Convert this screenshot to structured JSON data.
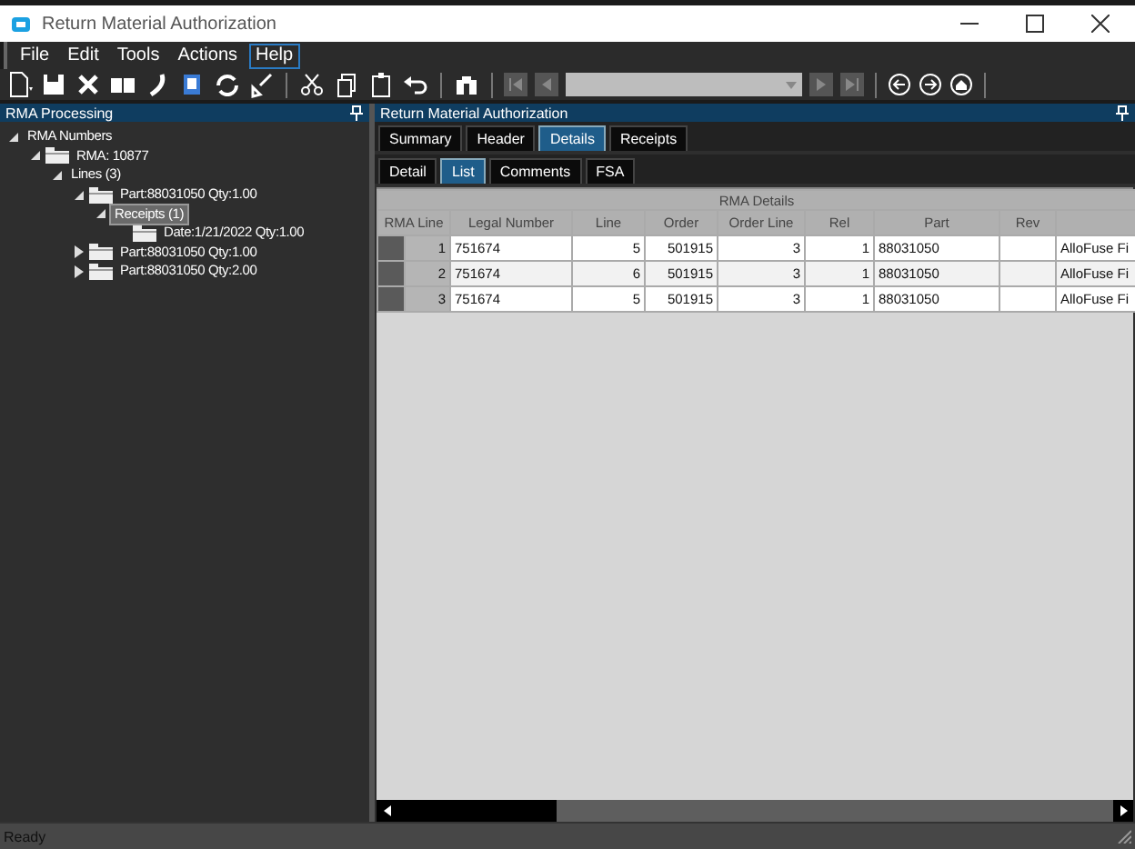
{
  "window": {
    "title": "Return Material Authorization"
  },
  "menu": [
    {
      "label": "File",
      "selected": false
    },
    {
      "label": "Edit",
      "selected": false
    },
    {
      "label": "Tools",
      "selected": false
    },
    {
      "label": "Actions",
      "selected": false
    },
    {
      "label": "Help",
      "selected": true
    }
  ],
  "tree_panel": {
    "title": "RMA Processing",
    "items": [
      {
        "label": "RMA Numbers",
        "folder": false,
        "expanded": true,
        "selected": false,
        "children": [
          {
            "label": "RMA: 10877",
            "folder": true,
            "expanded": true,
            "selected": false,
            "children": [
              {
                "label": "Lines (3)",
                "folder": false,
                "expanded": true,
                "selected": false,
                "children": [
                  {
                    "label": "Part:88031050 Qty:1.00",
                    "folder": true,
                    "expanded": true,
                    "selected": false,
                    "children": [
                      {
                        "label": "Receipts (1)",
                        "folder": false,
                        "expanded": true,
                        "selected": true,
                        "children": [
                          {
                            "label": "Date:1/21/2022 Qty:1.00",
                            "folder": true,
                            "selected": false
                          }
                        ]
                      }
                    ]
                  },
                  {
                    "label": "Part:88031050 Qty:1.00",
                    "folder": true,
                    "expanded": false,
                    "selected": false
                  },
                  {
                    "label": "Part:88031050 Qty:2.00",
                    "folder": true,
                    "expanded": false,
                    "selected": false
                  }
                ]
              }
            ]
          }
        ]
      }
    ]
  },
  "main_panel": {
    "title": "Return Material Authorization",
    "tabs": [
      {
        "label": "Summary",
        "selected": false
      },
      {
        "label": "Header",
        "selected": false
      },
      {
        "label": "Details",
        "selected": true
      },
      {
        "label": "Receipts",
        "selected": false
      }
    ],
    "subtabs": [
      {
        "label": "Detail",
        "selected": false
      },
      {
        "label": "List",
        "selected": true
      },
      {
        "label": "Comments",
        "selected": false
      },
      {
        "label": "FSA",
        "selected": false
      }
    ],
    "table": {
      "caption": "RMA Details",
      "columns": [
        "RMA Line",
        "Legal Number",
        "Line",
        "Order",
        "Order Line",
        "Rel",
        "Part",
        "Rev",
        ""
      ],
      "rows": [
        [
          "1",
          "751674",
          "5",
          "501915",
          "3",
          "1",
          "88031050",
          "",
          "AlloFuse Fi"
        ],
        [
          "2",
          "751674",
          "6",
          "501915",
          "3",
          "1",
          "88031050",
          "",
          "AlloFuse Fi"
        ],
        [
          "3",
          "751674",
          "5",
          "501915",
          "3",
          "1",
          "88031050",
          "",
          "AlloFuse Fi"
        ]
      ]
    }
  },
  "status_bar": {
    "text": "Ready"
  }
}
